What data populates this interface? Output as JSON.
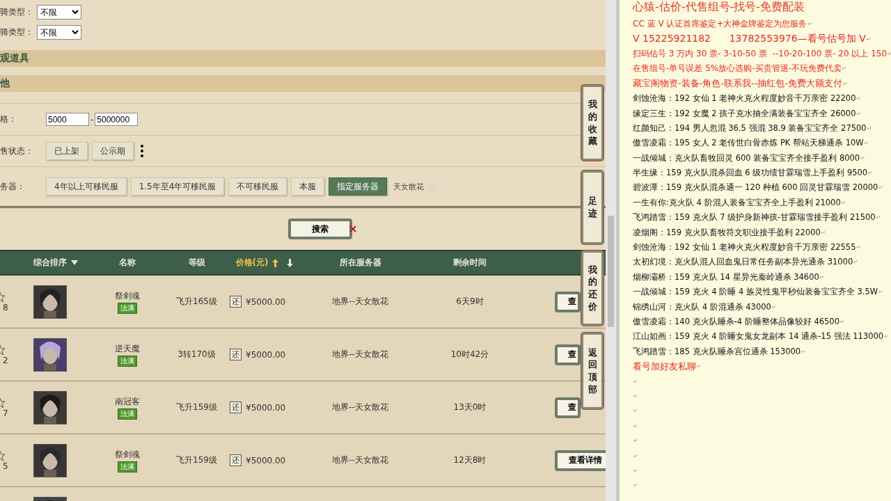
{
  "filters": [
    {
      "label": "骑类型：",
      "value": "不限"
    },
    {
      "label": "骑类型：",
      "value": "不限"
    }
  ],
  "sections": [
    "观道具",
    "他"
  ],
  "price_range": {
    "label": "格：",
    "min": "5000",
    "separator": "-",
    "max": "5000000"
  },
  "status": {
    "label": "售状态：",
    "options": [
      {
        "label": "已上架",
        "selected": false
      },
      {
        "label": "公示期",
        "selected": false
      }
    ]
  },
  "server": {
    "label": "务器：",
    "options": [
      {
        "label": "4年以上可移民服",
        "selected": false
      },
      {
        "label": "1.5年至4年可移民服",
        "selected": false
      },
      {
        "label": "不可移民服",
        "selected": false
      },
      {
        "label": "本服",
        "selected": false
      },
      {
        "label": "指定服务器",
        "selected": true
      }
    ],
    "chosen": "天女散花"
  },
  "search_button": "搜索",
  "table": {
    "columns": [
      {
        "label": "综合排序",
        "kind": "sort_down",
        "active": false
      },
      {
        "label": "名称",
        "kind": "plain",
        "active": false
      },
      {
        "label": "等级",
        "kind": "plain",
        "active": false
      },
      {
        "label": "价格(元)",
        "kind": "sort_both",
        "active": true
      },
      {
        "label": "所在服务器",
        "kind": "plain",
        "active": false
      },
      {
        "label": "剩余时间",
        "kind": "plain",
        "active": false
      }
    ],
    "rows": [
      {
        "favorites": "8",
        "name": "祭剑魂",
        "tag": "法满",
        "level": "飞升165级",
        "price_tag": "还",
        "price": "¥5000.00",
        "server": "地界--天女散花",
        "time": "6天9时",
        "action": "查"
      },
      {
        "favorites": "2",
        "name": "逆天魔",
        "tag": "法满",
        "level": "3转170级",
        "price_tag": "还",
        "price": "¥5000.00",
        "server": "地界--天女散花",
        "time": "10时42分",
        "action": "查"
      },
      {
        "favorites": "7",
        "name": "南冠客",
        "tag": "法满",
        "level": "飞升159级",
        "price_tag": "还",
        "price": "¥5000.00",
        "server": "地界--天女散花",
        "time": "13天0时",
        "action": "查"
      },
      {
        "favorites": "5",
        "name": "祭剑魂",
        "tag": "法满",
        "level": "飞升159级",
        "price_tag": "还",
        "price": "¥5000.00",
        "server": "地界--天女散花",
        "time": "12天8时",
        "action": "查看详情"
      }
    ]
  },
  "side_tabs": [
    "我的收藏",
    "足迹",
    "我的还价",
    "返回顶部"
  ],
  "notes": {
    "heading": "心猿-估价-代售组号-找号-免费配装",
    "lines": [
      {
        "kind": "ad",
        "text": "CC 蓝 V 认证首席鉴定+大神金牌鉴定为您服务",
        "mark": "↵"
      },
      {
        "kind": "contact",
        "text": "V 15225921182      13782553976—看号估号加 V",
        "mark": "↵"
      },
      {
        "kind": "ad",
        "text": "扫码估号 3 万内 30 票- 3-10-50 票  --10-20-100 票- 20 以上 150",
        "mark": "↵"
      },
      {
        "kind": "ad",
        "text": "在售组号-单号误差 5%放心选购-买贵管退-不玩免费代卖",
        "mark": "↵"
      },
      {
        "kind": "ad_large",
        "text": "藏宝阁物资-装备-角色-联系我--抽红包-免费大额支付",
        "mark": "↵"
      },
      {
        "kind": "listing",
        "text": "剑蚀沧海：192 女仙 1 老神火克火程度妙音千万亲密 22200",
        "mark": "↵"
      },
      {
        "kind": "listing",
        "text": "缘定三生：192 女魔 2 孩子克水抽全满装备宝宝齐全 26000",
        "mark": "↵"
      },
      {
        "kind": "listing",
        "text": "红颜知己：194 男人忽混 36.5 强混 38.9 装备宝宝齐全 27500",
        "mark": "↵"
      },
      {
        "kind": "listing",
        "text": "傲雪凌霜：195 女人 2 老传世白骨赤炼 PK 帮站天梯通杀 10W",
        "mark": "↵"
      },
      {
        "kind": "listing",
        "text": "一战倾城：克火队畜牧回灵 600 装备宝宝齐全接手盈利 8000",
        "mark": "↵"
      },
      {
        "kind": "listing",
        "text": "半生缘：159 克火队混杀回血 6 级功绩甘霖瑞雪上手盈利 9500",
        "mark": "↵"
      },
      {
        "kind": "listing",
        "text": "碧波潭：159 克火队混杀通一 120 种植 600 回灵甘霖瑞雪 20000",
        "mark": "↵"
      },
      {
        "kind": "listing",
        "text": "一生有你:克火队 4 阶混人装备宝宝齐全上手盈利 21000",
        "mark": "↵"
      },
      {
        "kind": "listing",
        "text": "飞鸿踏雪：159 克火队 7 级护身新神孩-甘霖瑞雪接手盈利 21500",
        "mark": "↵"
      },
      {
        "kind": "listing",
        "text": "凌烟阁：159 克火队畜牧符文职业接手盈利 22000",
        "mark": "↵"
      },
      {
        "kind": "listing",
        "text": "剑蚀沧海：192 女仙 1 老神火克火程度妙音千万亲密 22555",
        "mark": "↵"
      },
      {
        "kind": "listing",
        "text": "太初幻境：克火队混人回血鬼日常任务副本异光通杀 31000",
        "mark": "↵"
      },
      {
        "kind": "listing",
        "text": "烟柳灞桥：159 克火队 14 星异光秦岭通杀 34600",
        "mark": "↵"
      },
      {
        "kind": "listing",
        "text": "一战倾城：159 克火 4 阶睡 4 族灵性鬼平秒仙装备宝宝齐全 3.5W",
        "mark": "↵"
      },
      {
        "kind": "listing",
        "text": "锦绣山河：克火队 4 阶混通杀 43000",
        "mark": "↵"
      },
      {
        "kind": "listing",
        "text": "傲雪凌霜：140 克火队睡杀-4 阶睡整体品像较好 46500",
        "mark": "↵"
      },
      {
        "kind": "listing",
        "text": "江山如画：159 克火 4 阶睡女鬼女龙副本 14 通杀-15 强法 113000",
        "mark": "↵"
      },
      {
        "kind": "listing",
        "text": "飞鸿踏雪：185 克火队睡杀宫位通杀 153000",
        "mark": "↵"
      },
      {
        "kind": "ad_large",
        "text": "看号加好友私聊",
        "mark": "↵"
      }
    ],
    "blank_lines": [
      "↵",
      "↵",
      "↵",
      "↵",
      "↵",
      "↵",
      "↵",
      "↵"
    ]
  }
}
